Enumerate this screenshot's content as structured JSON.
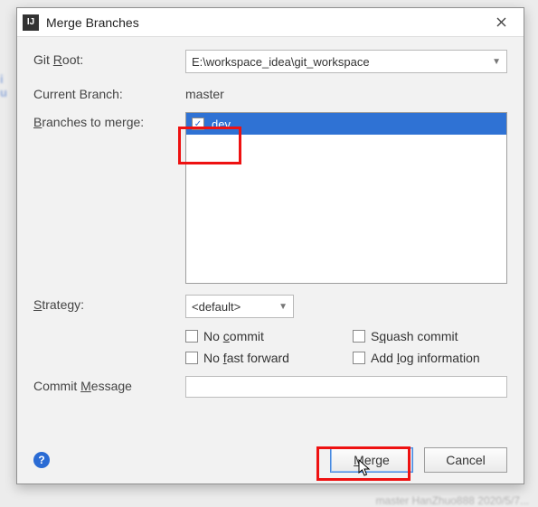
{
  "dialog": {
    "title": "Merge Branches"
  },
  "labels": {
    "git_root": "Git Root:",
    "git_root_u": "R",
    "current_branch": "Current Branch:",
    "branches_to_merge": "Branches to merge:",
    "branches_to_merge_u": "B",
    "strategy": "Strategy:",
    "strategy_u": "S",
    "commit_message": "Commit Message",
    "commit_message_u": "M"
  },
  "values": {
    "git_root": "E:\\workspace_idea\\git_workspace",
    "current_branch": "master",
    "strategy": "<default>",
    "commit_message": ""
  },
  "branches": [
    {
      "name": "dev",
      "checked": true,
      "selected": true
    }
  ],
  "options": {
    "no_commit": "No commit",
    "no_commit_u": "c",
    "squash": "Squash commit",
    "squash_u": "q",
    "no_ff": "No fast forward",
    "no_ff_u": "f",
    "add_log": "Add log information",
    "add_log_u": "l"
  },
  "buttons": {
    "merge": "Merge",
    "merge_u": "M",
    "cancel": "Cancel"
  }
}
